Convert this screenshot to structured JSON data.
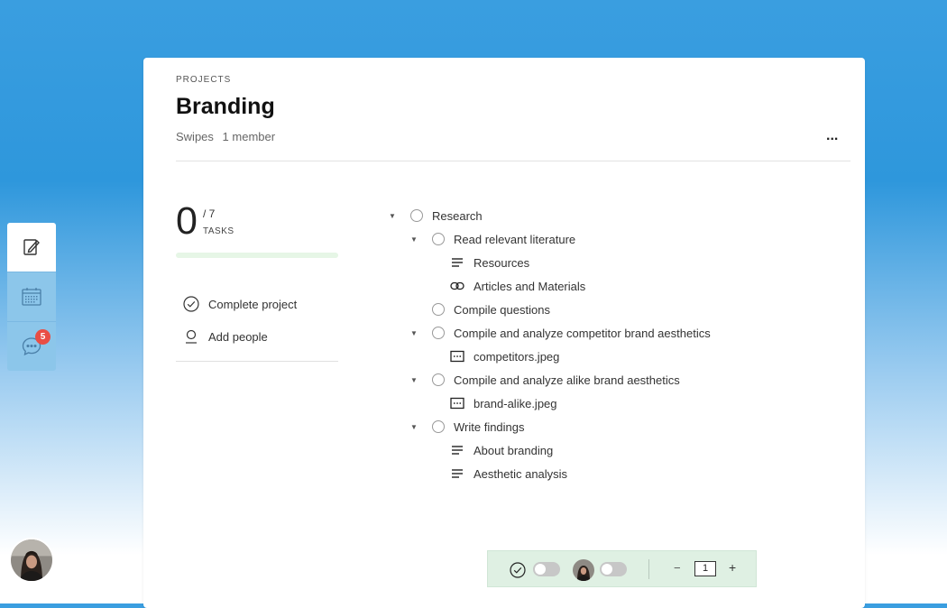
{
  "nav": {
    "items": [
      {
        "icon": "notes-icon"
      },
      {
        "icon": "calendar-icon"
      },
      {
        "icon": "chat-icon",
        "badge": "5"
      }
    ]
  },
  "project": {
    "breadcrumb": "PROJECTS",
    "title": "Branding",
    "workspace": "Swipes",
    "members": "1 member",
    "more_label": "..."
  },
  "stats": {
    "completed": "0",
    "total": "/ 7",
    "label": "TASKS",
    "progress_fraction": 0
  },
  "actions": {
    "complete": "Complete project",
    "add_people": "Add people"
  },
  "tree": [
    {
      "label": "Research",
      "kind": "task",
      "caret": true
    },
    {
      "label": "Read relevant literature",
      "kind": "task",
      "caret": true
    },
    {
      "label": "Resources",
      "kind": "note"
    },
    {
      "label": "Articles and Materials",
      "kind": "link"
    },
    {
      "label": "Compile questions",
      "kind": "task",
      "caret": false
    },
    {
      "label": "Compile and analyze competitor brand aesthetics",
      "kind": "task",
      "caret": true
    },
    {
      "label": "competitors.jpeg",
      "kind": "image"
    },
    {
      "label": "Compile and analyze alike brand aesthetics",
      "kind": "task",
      "caret": true
    },
    {
      "label": "brand-alike.jpeg",
      "kind": "image"
    },
    {
      "label": "Write findings",
      "kind": "task",
      "caret": true
    },
    {
      "label": "About branding",
      "kind": "note"
    },
    {
      "label": "Aesthetic analysis",
      "kind": "note"
    }
  ],
  "toolbar": {
    "minus": "−",
    "plus": "+",
    "page_value": "1"
  },
  "colors": {
    "progress": "#58c16e",
    "badge": "#e94e45",
    "toolbar_bg": "#dff0e3"
  }
}
